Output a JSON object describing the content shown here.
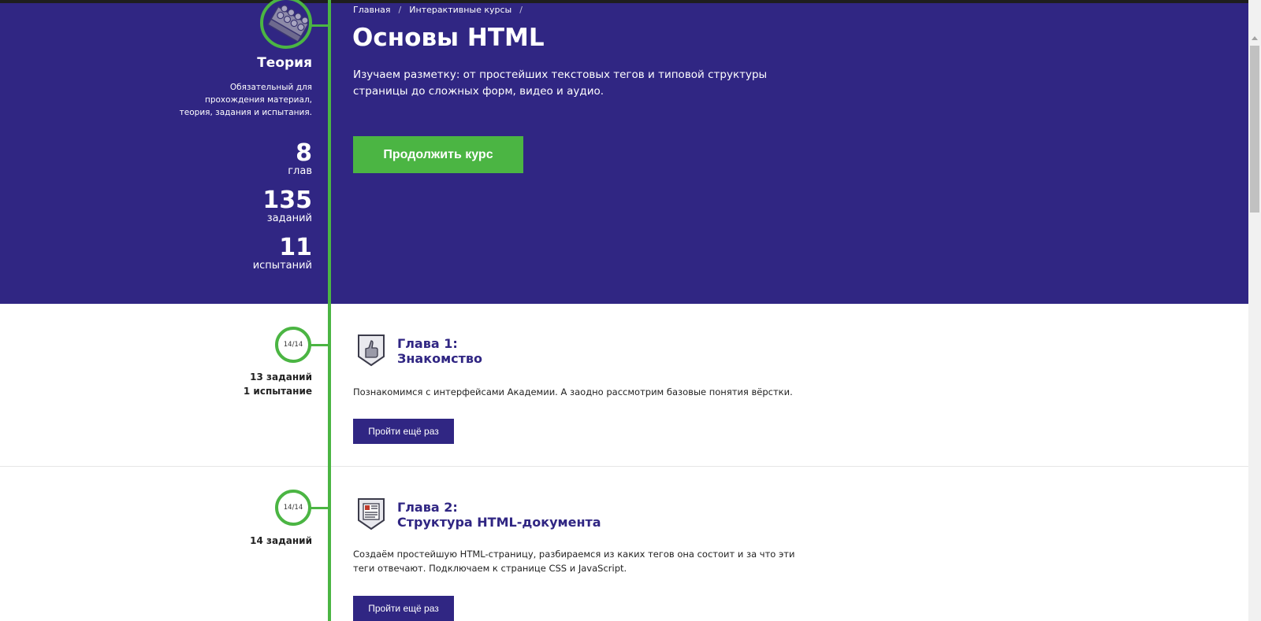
{
  "breadcrumb": {
    "home": "Главная",
    "courses": "Интерактивные курсы",
    "separator": "/"
  },
  "hero": {
    "title": "Основы HTML",
    "lead": "Изучаем разметку: от простейших текстовых тегов и типовой структуры страницы до сложных форм, видео и аудио.",
    "continue_label": "Продолжить курс"
  },
  "theory": {
    "icon": "lego-brick-icon",
    "title": "Теория",
    "description": "Обязательный для прохождения материал, теория, задания и испытания.",
    "stats": [
      {
        "value": "8",
        "label": "глав"
      },
      {
        "value": "135",
        "label": "заданий"
      },
      {
        "value": "11",
        "label": "испытаний"
      }
    ]
  },
  "chapters": [
    {
      "progress": "14/14",
      "stats": [
        "13 заданий",
        "1 испытание"
      ],
      "icon": "thumbs-up-shield-icon",
      "title_line1": "Глава 1:",
      "title_line2": "Знакомство",
      "description": "Познакомимся с интерфейсами Академии. А заодно рассмотрим базовые понятия вёрстки.",
      "button_label": "Пройти ещё раз"
    },
    {
      "progress": "14/14",
      "stats": [
        "14 заданий"
      ],
      "icon": "document-shield-icon",
      "title_line1": "Глава 2:",
      "title_line2": "Структура HTML-документа",
      "description": "Создаём простейшую HTML-страницу, разбираемся из каких тегов она состоит и за что эти теги отвечают. Подключаем к странице CSS и JavaScript.",
      "button_label": "Пройти ещё раз"
    }
  ],
  "colors": {
    "primary": "#302683",
    "accent": "#4bb543",
    "background": "#ffffff"
  }
}
